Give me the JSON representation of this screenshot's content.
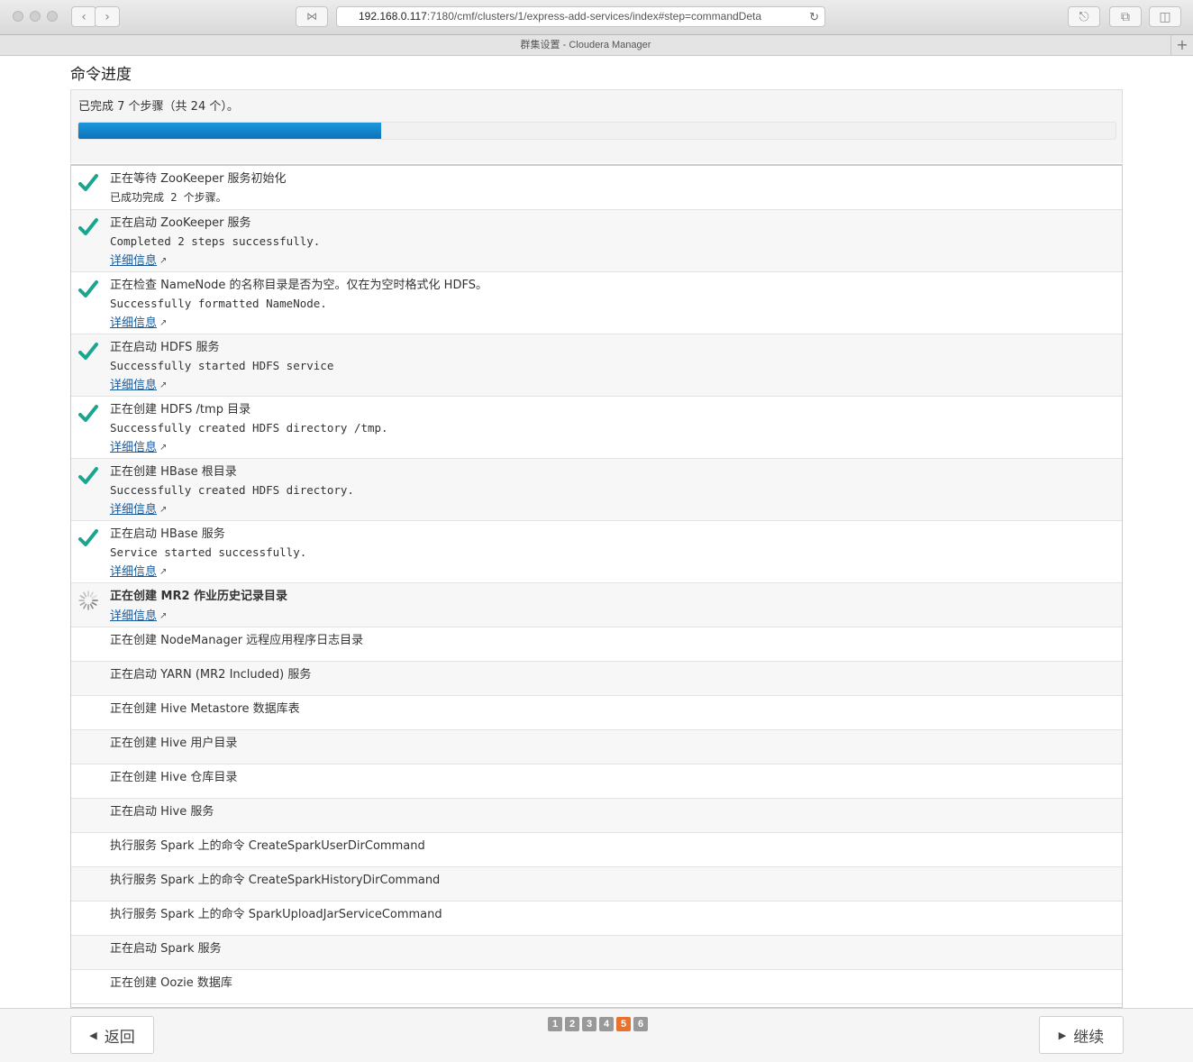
{
  "browser": {
    "url_host": "192.168.0.117",
    "url_rest": ":7180/cmf/clusters/1/express-add-services/index#step=commandDeta",
    "tab_title": "群集设置 - Cloudera Manager",
    "reader_icon": "reader-icon",
    "reload_glyph": "↻",
    "new_tab_glyph": "+"
  },
  "page": {
    "title": "命令进度",
    "progress_text": "已完成 7 个步骤（共 24 个）。",
    "progress_completed": 7,
    "progress_total": 24,
    "progress_fraction": 0.2917,
    "progress_color": "#1a8bd0"
  },
  "colors": {
    "check": "#1aa58f",
    "link": "#1a5a9a",
    "active_page": "#e8722c"
  },
  "steps": [
    {
      "status": "done",
      "title": "正在等待 ZooKeeper 服务初始化",
      "message": "已成功完成 2 个步骤。",
      "message_cn": true,
      "link": ""
    },
    {
      "status": "done",
      "title": "正在启动 ZooKeeper 服务",
      "message": "Completed 2 steps successfully.",
      "link": "详细信息"
    },
    {
      "status": "done",
      "title": "正在检查 NameNode 的名称目录是否为空。仅在为空时格式化 HDFS。",
      "message": "Successfully formatted NameNode.",
      "link": "详细信息"
    },
    {
      "status": "done",
      "title": "正在启动 HDFS 服务",
      "message": "Successfully started HDFS service",
      "link": "详细信息"
    },
    {
      "status": "done",
      "title": "正在创建 HDFS /tmp 目录",
      "message": "Successfully created HDFS directory /tmp.",
      "link": "详细信息"
    },
    {
      "status": "done",
      "title": "正在创建 HBase 根目录",
      "message": "Successfully created HDFS directory.",
      "link": "详细信息"
    },
    {
      "status": "done",
      "title": "正在启动 HBase 服务",
      "message": "Service started successfully.",
      "link": "详细信息"
    },
    {
      "status": "running",
      "title": "正在创建 MR2 作业历史记录目录",
      "message": "",
      "link": "详细信息"
    },
    {
      "status": "pending",
      "title": "正在创建 NodeManager 远程应用程序日志目录"
    },
    {
      "status": "pending",
      "title": "正在启动 YARN (MR2 Included) 服务"
    },
    {
      "status": "pending",
      "title": "正在创建 Hive Metastore 数据库表"
    },
    {
      "status": "pending",
      "title": "正在创建 Hive 用户目录"
    },
    {
      "status": "pending",
      "title": "正在创建 Hive 仓库目录"
    },
    {
      "status": "pending",
      "title": "正在启动 Hive 服务"
    },
    {
      "status": "pending",
      "title": "执行服务 Spark 上的命令 CreateSparkUserDirCommand"
    },
    {
      "status": "pending",
      "title": "执行服务 Spark 上的命令 CreateSparkHistoryDirCommand"
    },
    {
      "status": "pending",
      "title": "执行服务 Spark 上的命令 SparkUploadJarServiceCommand"
    },
    {
      "status": "pending",
      "title": "正在启动 Spark 服务"
    },
    {
      "status": "pending",
      "title": "正在创建 Oozie 数据库"
    }
  ],
  "footer": {
    "back_label": "返回",
    "continue_label": "继续",
    "pages": [
      "1",
      "2",
      "3",
      "4",
      "5",
      "6"
    ],
    "active_page": "5"
  }
}
